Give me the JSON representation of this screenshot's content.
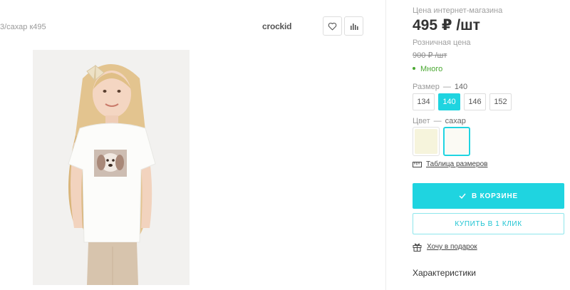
{
  "product": {
    "sku_text": "3/сахар к495",
    "brand": "crockid"
  },
  "panel": {
    "online_price_label": "Цена интернет-магазина",
    "price": "495 ₽ /шт",
    "retail_label": "Розничная цена",
    "old_price": "900 ₽ /шт",
    "stock": "Много",
    "size_label": "Размер",
    "size_dash": "—",
    "size_selected": "140",
    "sizes": [
      "134",
      "140",
      "146",
      "152"
    ],
    "color_label": "Цвет",
    "color_dash": "—",
    "color_selected": "сахар",
    "swatch_colors": [
      "#f6f4dc",
      "#fbfaf4"
    ],
    "size_table_link": "Таблица размеров",
    "cart_button": "В КОРЗИНЕ",
    "one_click_button": "КУПИТЬ В 1 КЛИК",
    "gift_link": "Хочу в подарок",
    "specs_heading": "Характеристики"
  },
  "colors": {
    "accent": "#1fd4e0",
    "in_stock": "#4aa832"
  }
}
